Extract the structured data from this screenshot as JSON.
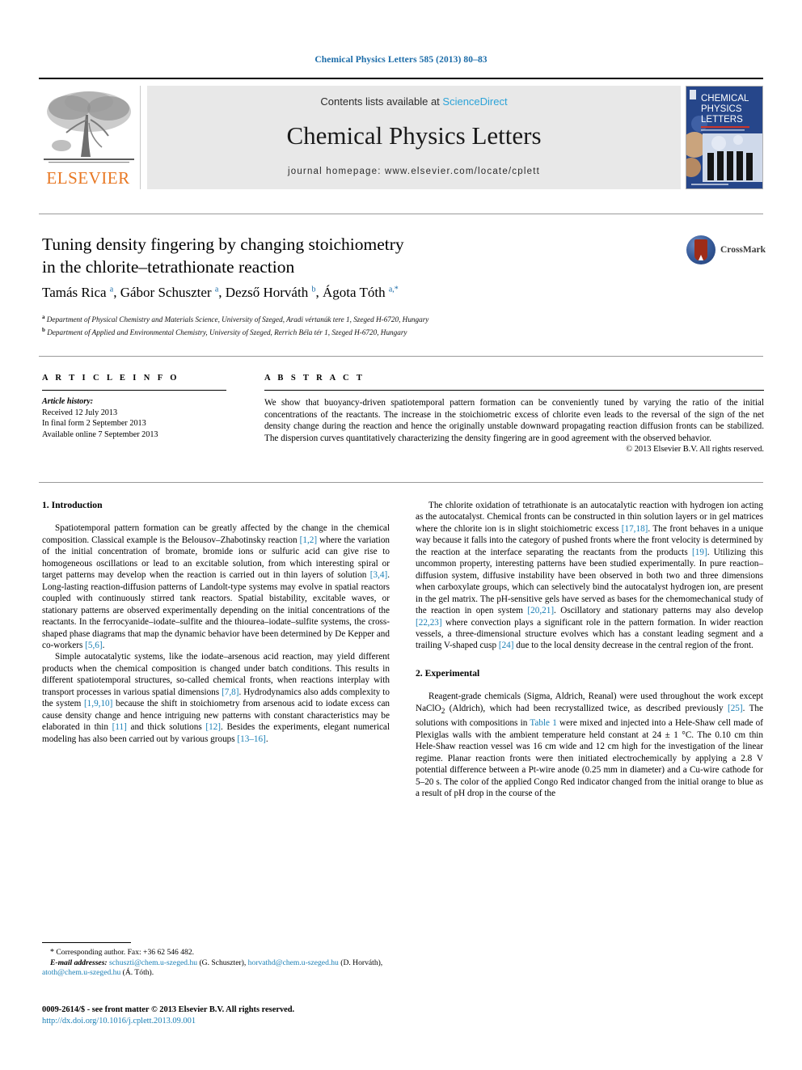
{
  "running_head": "Chemical Physics Letters 585 (2013) 80–83",
  "masthead": {
    "publisher_name": "ELSEVIER",
    "contents_prefix": "Contents lists available at ",
    "contents_link": "ScienceDirect",
    "journal_title": "Chemical Physics Letters",
    "homepage": "journal homepage: www.elsevier.com/locate/cplett",
    "cover": {
      "line1": "CHEMICAL",
      "line2": "PHYSICS",
      "line3": "LETTERS"
    }
  },
  "article": {
    "title_line1": "Tuning density fingering by changing stoichiometry",
    "title_line2": "in the chlorite–tetrathionate reaction",
    "crossmark_label": "CrossMark",
    "authors_html": "Tamás Rica <sup>a</sup>, Gábor Schuszter <sup>a</sup>, Dezső Horváth <sup>b</sup>, Ágota Tóth <sup>a,*</sup>",
    "affiliation_a": "Department of Physical Chemistry and Materials Science, University of Szeged, Aradi vértanúk tere 1, Szeged H-6720, Hungary",
    "affiliation_b": "Department of Applied and Environmental Chemistry, University of Szeged, Rerrich Béla tér 1, Szeged H-6720, Hungary"
  },
  "article_info": {
    "heading": "A R T I C L E   I N F O",
    "history_label": "Article history:",
    "received": "Received 12 July 2013",
    "final_form": "In final form 2 September 2013",
    "available_online": "Available online 7 September 2013"
  },
  "abstract": {
    "heading": "A B S T R A C T",
    "text": "We show that buoyancy-driven spatiotemporal pattern formation can be conveniently tuned by varying the ratio of the initial concentrations of the reactants. The increase in the stoichiometric excess of chlorite even leads to the reversal of the sign of the net density change during the reaction and hence the originally unstable downward propagating reaction diffusion fronts can be stabilized. The dispersion curves quantitatively characterizing the density fingering are in good agreement with the observed behavior.",
    "copyright": "© 2013 Elsevier B.V. All rights reserved."
  },
  "sections": {
    "introduction_heading": "1. Introduction",
    "experimental_heading": "2. Experimental"
  },
  "body": {
    "intro_p1_html": "Spatiotemporal pattern formation can be greatly affected by the change in the chemical composition. Classical example is the Belousov–Zhabotinsky reaction <span class=\"ref\">[1,2]</span> where the variation of the initial concentration of bromate, bromide ions or sulfuric acid can give rise to homogeneous oscillations or lead to an excitable solution, from which interesting spiral or target patterns may develop when the reaction is carried out in thin layers of solution <span class=\"ref\">[3,4]</span>. Long-lasting reaction-diffusion patterns of Landolt-type systems may evolve in spatial reactors coupled with continuously stirred tank reactors. Spatial bistability, excitable waves, or stationary patterns are observed experimentally depending on the initial concentrations of the reactants. In the ferrocyanide–iodate–sulfite and the thiourea–iodate–sulfite systems, the cross-shaped phase diagrams that map the dynamic behavior have been determined by De Kepper and co-workers <span class=\"ref\">[5,6]</span>.",
    "intro_p2_html": "Simple autocatalytic systems, like the iodate–arsenous acid reaction, may yield different products when the chemical composition is changed under batch conditions. This results in different spatiotemporal structures, so-called chemical fronts, when reactions interplay with transport processes in various spatial dimensions <span class=\"ref\">[7,8]</span>. Hydrodynamics also adds complexity to the system <span class=\"ref\">[1,9,10]</span> because the shift in stoichiometry from arsenous acid to iodate excess can cause density change and hence intriguing new patterns with constant characteristics may be elaborated in thin <span class=\"ref\">[11]</span> and thick solutions <span class=\"ref\">[12]</span>. Besides the experiments, elegant numerical modeling has also been carried out by various groups <span class=\"ref\">[13–16]</span>.",
    "right_p1_html": "The chlorite oxidation of tetrathionate is an autocatalytic reaction with hydrogen ion acting as the autocatalyst. Chemical fronts can be constructed in thin solution layers or in gel matrices where the chlorite ion is in slight stoichiometric excess <span class=\"ref\">[17,18]</span>. The front behaves in a unique way because it falls into the category of pushed fronts where the front velocity is determined by the reaction at the interface separating the reactants from the products <span class=\"ref\">[19]</span>. Utilizing this uncommon property, interesting patterns have been studied experimentally. In pure reaction–diffusion system, diffusive instability have been observed in both two and three dimensions when carboxylate groups, which can selectively bind the autocatalyst hydrogen ion, are present in the gel matrix. The pH-sensitive gels have served as bases for the chemomechanical study of the reaction in open system <span class=\"ref\">[20,21]</span>. Oscillatory and stationary patterns may also develop <span class=\"ref\">[22,23]</span> where convection plays a significant role in the pattern formation. In wider reaction vessels, a three-dimensional structure evolves which has a constant leading segment and a trailing V-shaped cusp <span class=\"ref\">[24]</span> due to the local density decrease in the central region of the front.",
    "exp_p1_html": "Reagent-grade chemicals (Sigma, Aldrich, Reanal) were used throughout the work except NaClO<sub>2</sub> (Aldrich), which had been recrystallized twice, as described previously <span class=\"ref\">[25]</span>. The solutions with compositions in <span class=\"ref\">Table 1</span> were mixed and injected into a Hele-Shaw cell made of Plexiglas walls with the ambient temperature held constant at 24 ± 1 °C. The 0.10 cm thin Hele-Shaw reaction vessel was 16 cm wide and 12 cm high for the investigation of the linear regime. Planar reaction fronts were then initiated electrochemically by applying a 2.8 V potential difference between a Pt-wire anode (0.25 mm in diameter) and a Cu-wire cathode for 5–20 s. The color of the applied Congo Red indicator changed from the initial orange to blue as a result of pH drop in the course of the"
  },
  "footnotes": {
    "corresponding_html": "<span style=\"font-size:10px\">*</span> Corresponding author. Fax: +36 62 546 482.",
    "emails_html": "<span class=\"em\">E-mail addresses:</span> <span class=\"link\">schuszti@chem.u-szeged.hu</span> (G. Schuszter), <span class=\"link\">horvathd@chem.u-szeged.hu</span> (D. Horváth), <span class=\"link\">atoth@chem.u-szeged.hu</span> (Á. Tóth)."
  },
  "colophon": {
    "issn_line": "0009-2614/$ - see front matter © 2013 Elsevier B.V. All rights reserved.",
    "doi": "http://dx.doi.org/10.1016/j.cplett.2013.09.001"
  },
  "colors": {
    "link_blue": "#1a7fb5",
    "running_head_blue": "#1a6ba8",
    "sciencedirect_blue": "#2ca3d8",
    "elsevier_orange": "#E87722",
    "banner_gray": "#e8e8e8"
  }
}
